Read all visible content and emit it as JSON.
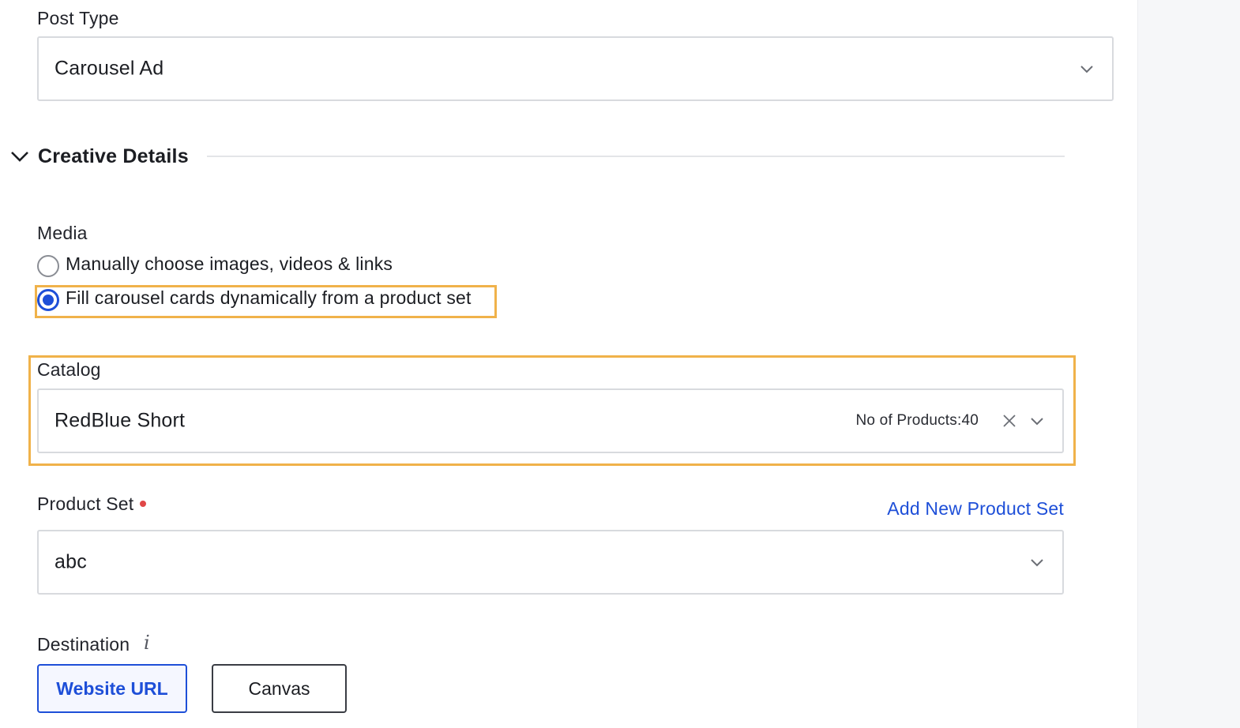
{
  "post_type": {
    "label": "Post Type",
    "value": "Carousel Ad"
  },
  "creative_details": {
    "title": "Creative Details"
  },
  "media": {
    "label": "Media",
    "options": [
      {
        "label": "Manually choose images, videos & links",
        "selected": false
      },
      {
        "label": "Fill carousel cards dynamically from a product set",
        "selected": true
      }
    ]
  },
  "catalog": {
    "label": "Catalog",
    "value": "RedBlue Short",
    "product_count": "No of Products:40"
  },
  "product_set": {
    "label": "Product Set",
    "add_link": "Add New Product Set",
    "value": "abc"
  },
  "destination": {
    "label": "Destination",
    "info_glyph": "i",
    "buttons": [
      {
        "label": "Website URL",
        "active": true
      },
      {
        "label": "Canvas",
        "active": false
      }
    ]
  },
  "colors": {
    "accent": "#1e4fd8",
    "highlight": "#f0b24a",
    "required": "#e04747"
  }
}
